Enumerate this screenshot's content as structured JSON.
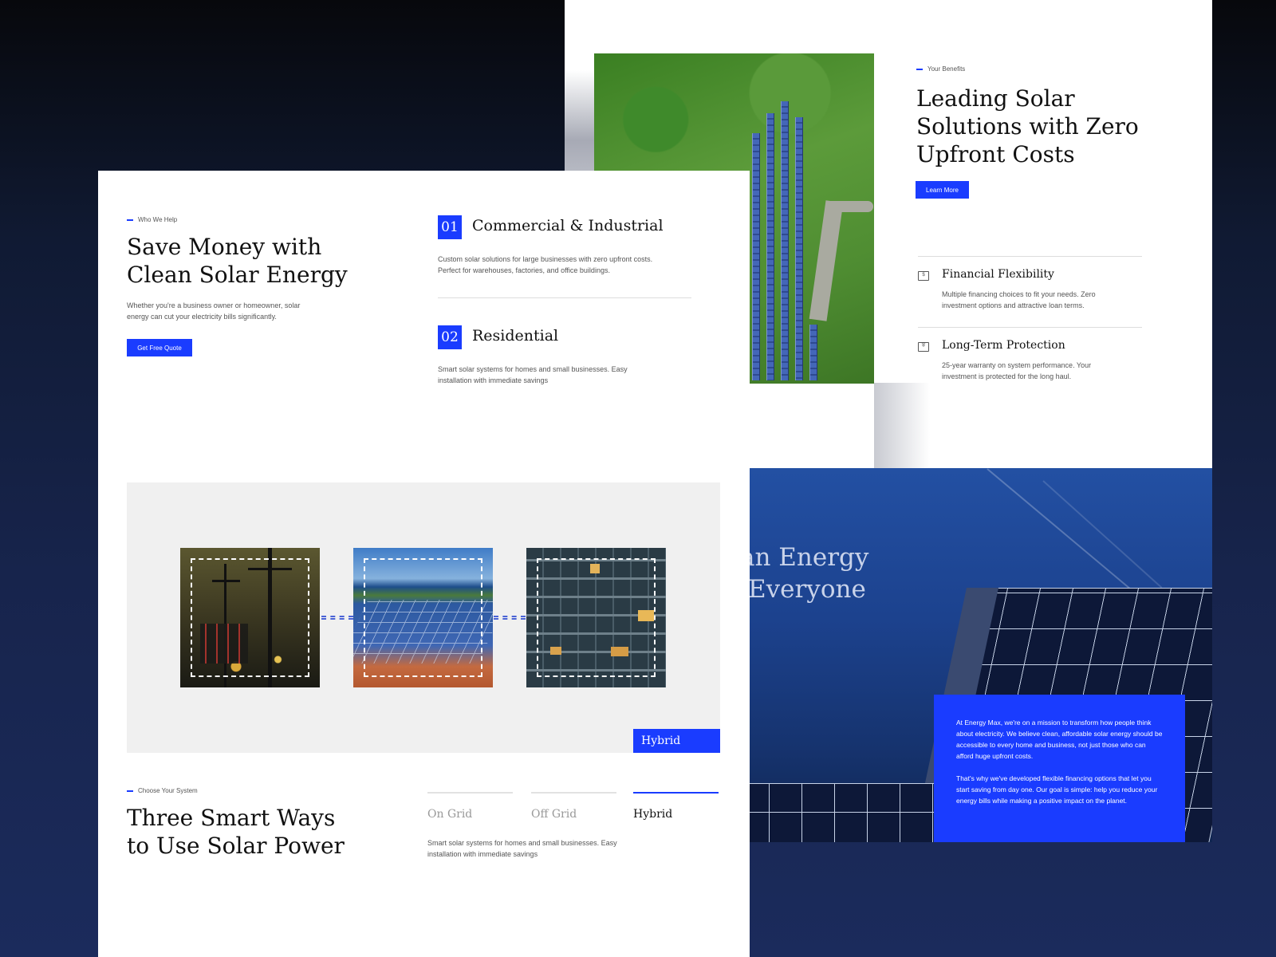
{
  "benefits_page": {
    "eyebrow": "Your Benefits",
    "heading": "Leading Solar Solutions with Zero Upfront Costs",
    "heading_lines": [
      "Leading Solar",
      "Solutions with Zero",
      "Upfront Costs"
    ],
    "cta_label": "Learn More",
    "items": [
      {
        "icon": "money-icon",
        "title": "Financial Flexibility",
        "desc": "Multiple financing choices to fit your needs. Zero investment options and attractive loan terms."
      },
      {
        "icon": "shield-icon",
        "title": "Long-Term Protection",
        "desc": "25-year warranty on system performance. Your investment is protected for the long haul."
      }
    ]
  },
  "hero_section": {
    "partial_heading_line1": "an Energy",
    "partial_heading_line2": "Everyone",
    "mission_p1": "At Energy Max, we're on a mission to transform how people think about electricity. We believe clean, affordable solar energy should be accessible to every home and business, not just those who can afford huge upfront costs.",
    "mission_p2": "That's why we've developed flexible financing options that let you start saving from day one. Our goal is simple: help you reduce your energy bills while making a positive impact on the planet."
  },
  "who_we_help": {
    "eyebrow": "Who We Help",
    "heading_lines": [
      "Save Money with",
      "Clean Solar Energy"
    ],
    "subtitle": "Whether you're a business owner or homeowner, solar energy can cut your electricity bills significantly.",
    "cta_label": "Get Free Quote",
    "services": [
      {
        "num": "01",
        "title": "Commercial & Industrial",
        "desc": "Custom solar solutions for large businesses with zero upfront costs. Perfect for warehouses, factories, and office buildings."
      },
      {
        "num": "02",
        "title": "Residential",
        "desc": "Smart solar systems for homes and small businesses. Easy installation with immediate savings"
      }
    ]
  },
  "systems": {
    "badge": "Hybrid",
    "eyebrow": "Choose Your System",
    "heading_lines": [
      "Three Smart Ways",
      "to Use Solar Power"
    ],
    "tabs": [
      "On Grid",
      "Off Grid",
      "Hybrid"
    ],
    "active_tab": "Hybrid",
    "desc": "Smart solar systems for homes and small businesses. Easy installation with immediate savings"
  },
  "colors": {
    "accent": "#1a3cff",
    "text": "#111111",
    "muted": "#555555"
  }
}
